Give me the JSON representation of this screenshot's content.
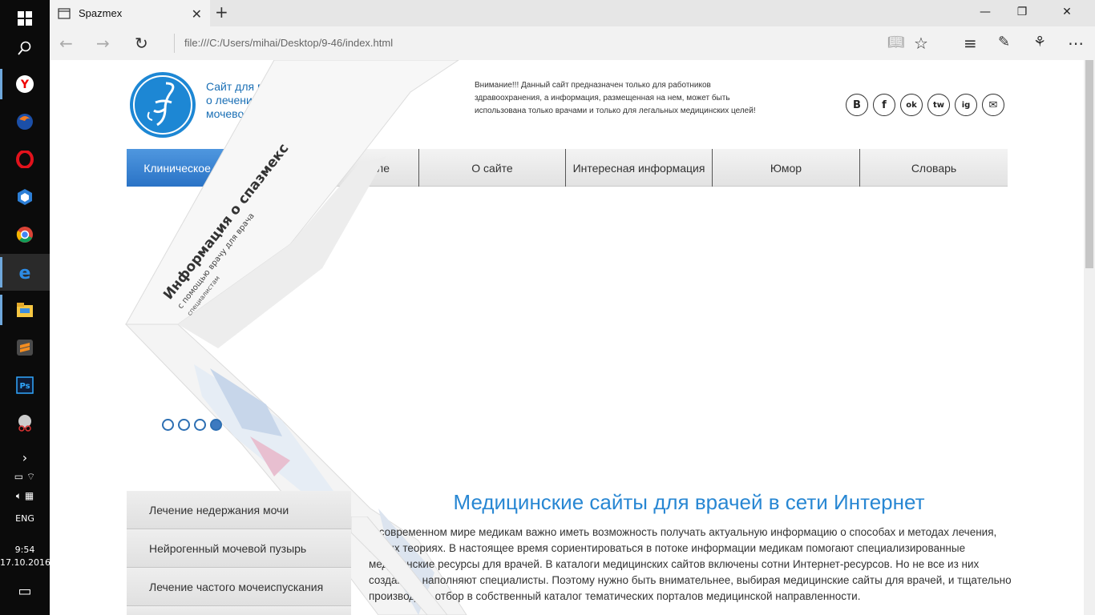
{
  "taskbar": {
    "language": "ENG",
    "time": "9:54",
    "date": "17.10.2016",
    "apps": [
      "windows-start-icon",
      "search-icon",
      "yandex-icon",
      "firefox-icon",
      "opera-icon",
      "app-hex-icon",
      "chrome-icon",
      "edge-icon",
      "file-explorer-icon",
      "sublime-icon",
      "photoshop-icon",
      "app-scissors-icon"
    ]
  },
  "browser": {
    "tab_title": "Spazmex",
    "tab_close": "✕",
    "new_tab": "+",
    "address": "file:///C:/Users/mihai/Desktop/9-46/index.html",
    "win_min": "—",
    "win_max": "❐",
    "win_close": "✕"
  },
  "header": {
    "title": "Сайт для врачей о лечении синдрома гиперактивного мочевого пузыря (ГАМП)",
    "title_line1": "Сайт для врачей",
    "title_line2": "о лечении синдрома гипе",
    "title_line3": "мочевого пузыря (ГАМП)",
    "warning": "Внимание!!! Данный сайт предназначен только для работников здравоохранения, а информация, размещенная на нем, может быть использована только врачами и только для легальных медицинских целей!",
    "social": [
      "B",
      "f",
      "ok",
      "tw",
      "ig",
      "✉"
    ]
  },
  "menu": {
    "items": [
      {
        "label": "Клиническое течение",
        "active": true
      },
      {
        "label": "ителе",
        "active": false
      },
      {
        "label": "О сайте",
        "active": false
      },
      {
        "label": "Интересная информация",
        "active": false
      },
      {
        "label": "Юмор",
        "active": false
      },
      {
        "label": "Словарь",
        "active": false
      }
    ]
  },
  "slider": {
    "panel_text_1": "Информация о спазмекс",
    "panel_text_2": "с помощью врачу для врача",
    "panel_text_3": "специалистам",
    "dots": 4,
    "active_dot": 4
  },
  "sidebar": {
    "items": [
      "Лечение недержания мочи",
      "Нейрогенный мочевой пузырь",
      "Лечение частого мочеиспускания"
    ]
  },
  "main": {
    "heading": "Медицинские сайты для врачей в сети Интернет",
    "paragraph": "В современном мире медикам важно иметь возможность получать актуальную информацию о способах и методах лечения, новых теориях. В настоящее время сориентироваться в потоке информации медикам помогают специализированные медицинские ресурсы для врачей. В каталоги медицинских сайтов включены сотни Интернет-ресурсов. Но не все из них создают и наполняют специалисты. Поэтому нужно быть внимательнее, выбирая медицинские сайты для врачей, и тщательно производить отбор в собственный каталог тематических порталов медицинской направленности."
  },
  "colors": {
    "accent": "#2887d3",
    "menu_active": "#2a73c6",
    "taskbar": "#0b0b0b"
  }
}
